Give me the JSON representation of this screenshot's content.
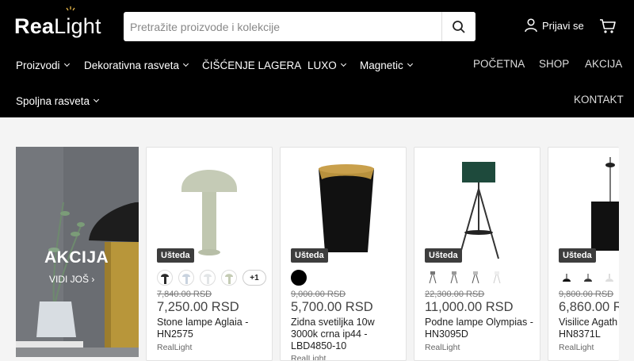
{
  "header": {
    "logo_bold": "Rea",
    "logo_light": "Light",
    "search_placeholder": "Pretražite proizvode i kolekcije",
    "login_label": "Prijavi se"
  },
  "nav": {
    "left": [
      {
        "label": "Proizvodi",
        "dropdown": true
      },
      {
        "label": "Dekorativna rasveta",
        "dropdown": true
      },
      {
        "label": "ČIŠĆENJE LAGERA",
        "dropdown": false
      },
      {
        "label": "LUXO",
        "dropdown": true
      },
      {
        "label": "Magnetic",
        "dropdown": true
      }
    ],
    "left_row2": [
      {
        "label": "Spoljna rasveta",
        "dropdown": true
      }
    ],
    "right": [
      "POČETNA",
      "SHOP",
      "AKCIJA"
    ],
    "right_row2": [
      "KONTAKT"
    ]
  },
  "promo": {
    "title": "AKCIJA",
    "link": "VIDI JOŠ"
  },
  "products": [
    {
      "badge": "Ušteda",
      "old_price": "7,840.00 RSD",
      "price": "7,250.00 RSD",
      "name": "Stone lampe Aglaia - HN2575",
      "brand": "RealLight",
      "more_swatches": "+1",
      "swatch_colors": [
        "#2a2a2a",
        "#c9d3df",
        "#e9ecee",
        "#c4cbb4"
      ]
    },
    {
      "badge": "Ušteda",
      "old_price": "9,000.00 RSD",
      "price": "5,700.00 RSD",
      "name": "Zidna svetiljka 10w 3000k crna ip44 - LBD4850-10",
      "brand": "RealLight",
      "swatch_colors": [
        "#000000"
      ]
    },
    {
      "badge": "Ušteda",
      "old_price": "22,300.00 RSD",
      "price": "11,000.00 RSD",
      "name": "Podne lampe Olympias -HN3095D",
      "brand": "RealLight",
      "swatch_colors": [
        "#ffffff",
        "#ffffff",
        "#ffffff",
        "#ffffff"
      ]
    },
    {
      "badge": "Ušteda",
      "old_price": "9,800.00 RSD",
      "price": "6,860.00 RSD",
      "name": "Visilice Agath HN8371L",
      "brand": "RealLight",
      "swatch_colors": [
        "#111111",
        "#333333",
        "#eeeeee"
      ]
    }
  ],
  "colors": {
    "header_bg": "#000000",
    "badge_bg": "#3d3d3d",
    "page_bg": "#f4f4f4"
  }
}
